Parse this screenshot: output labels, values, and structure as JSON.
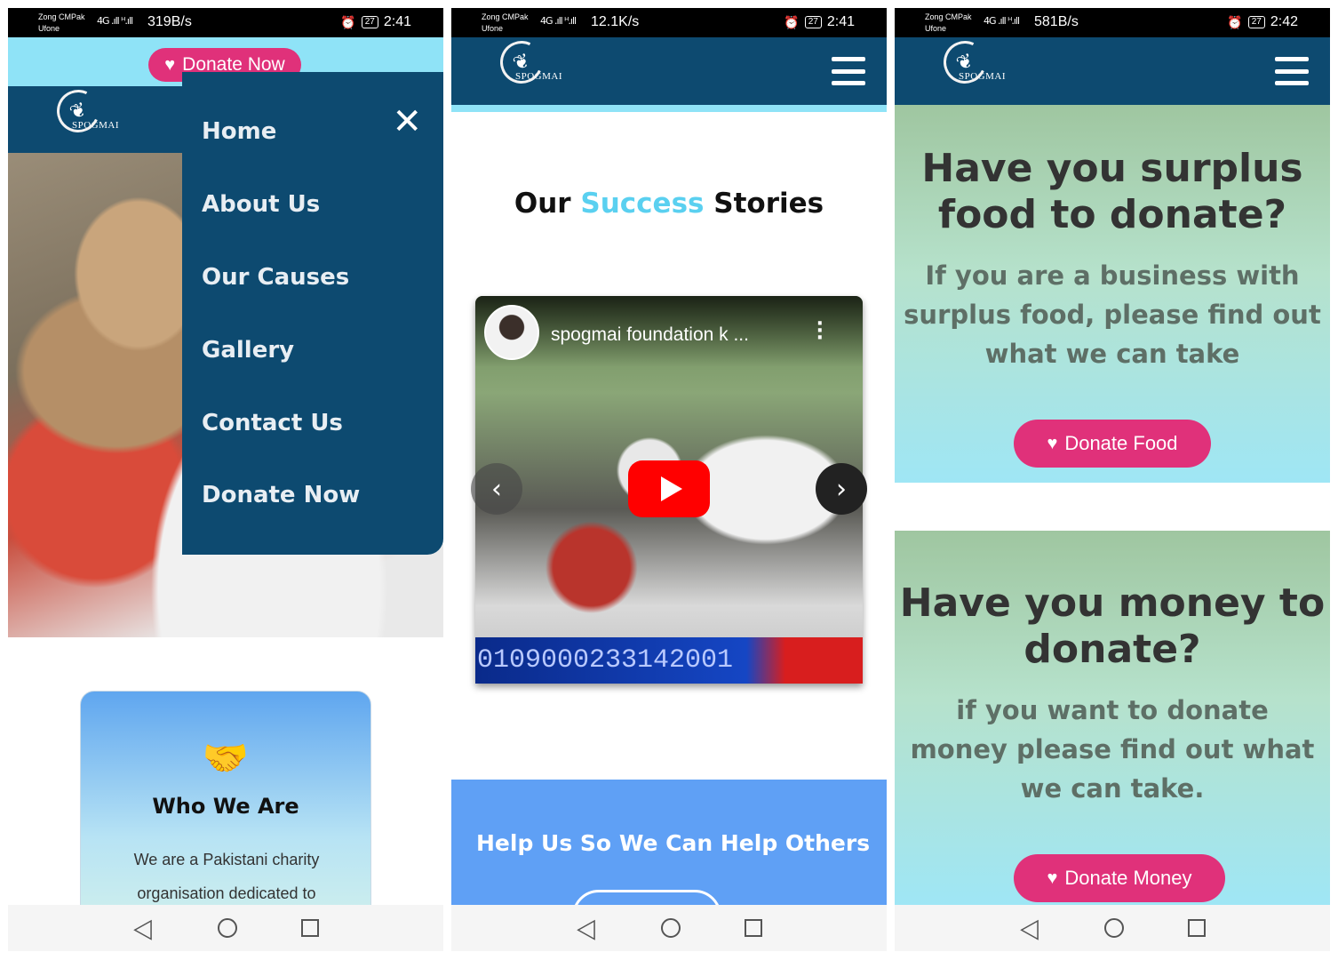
{
  "phone1": {
    "status": {
      "carrier1": "Zong CMPak",
      "carrier2": "Ufone",
      "signal": "4G .ıll ᴴ.ıll",
      "speed": "319B/s",
      "alarm": "⏰",
      "battery": "27",
      "time": "2:41"
    },
    "donate_now": "Donate Now",
    "logo_text": "SPOGMAI",
    "menu": [
      "Home",
      "About Us",
      "Our Causes",
      "Gallery",
      "Contact Us",
      "Donate Now"
    ],
    "card": {
      "icon": "handshake-icon",
      "icon_glyph": "🤝",
      "title": "Who We Are",
      "text": "We are a Pakistani charity organisation dedicated to"
    }
  },
  "phone2": {
    "status": {
      "carrier1": "Zong CMPak",
      "carrier2": "Ufone",
      "signal": "4G .ıll ᴴ.ıll",
      "speed": "12.1K/s",
      "alarm": "⏰",
      "battery": "27",
      "time": "2:41"
    },
    "logo_text": "SPOGMAI",
    "stories": {
      "part1": "Our",
      "part2": "Success",
      "part3": "Stories"
    },
    "video": {
      "title": "spogmai foundation k ...",
      "ticker": "0109000233142001"
    },
    "banner_title": "Help Us So We Can Help Others"
  },
  "phone3": {
    "status": {
      "carrier1": "Zong CMPak",
      "carrier2": "Ufone",
      "signal": "4G .ıll ᴴ.ıll",
      "speed": "581B/s",
      "alarm": "⏰",
      "battery": "27",
      "time": "2:42"
    },
    "logo_text": "SPOGMAI",
    "food": {
      "title": "Have you surplus food to donate?",
      "sub": "If you are a business with surplus food, please find out what we can take",
      "button": "Donate Food"
    },
    "money": {
      "title": "Have you money to donate?",
      "sub": "if you want to donate money please find out what we can take.",
      "button": "Donate Money"
    }
  },
  "colors": {
    "navy": "#0d4a70",
    "cyan": "#8fe3f7",
    "pink": "#e0317a",
    "blue": "#5fa0f5",
    "highlight": "#5ad0f0"
  }
}
